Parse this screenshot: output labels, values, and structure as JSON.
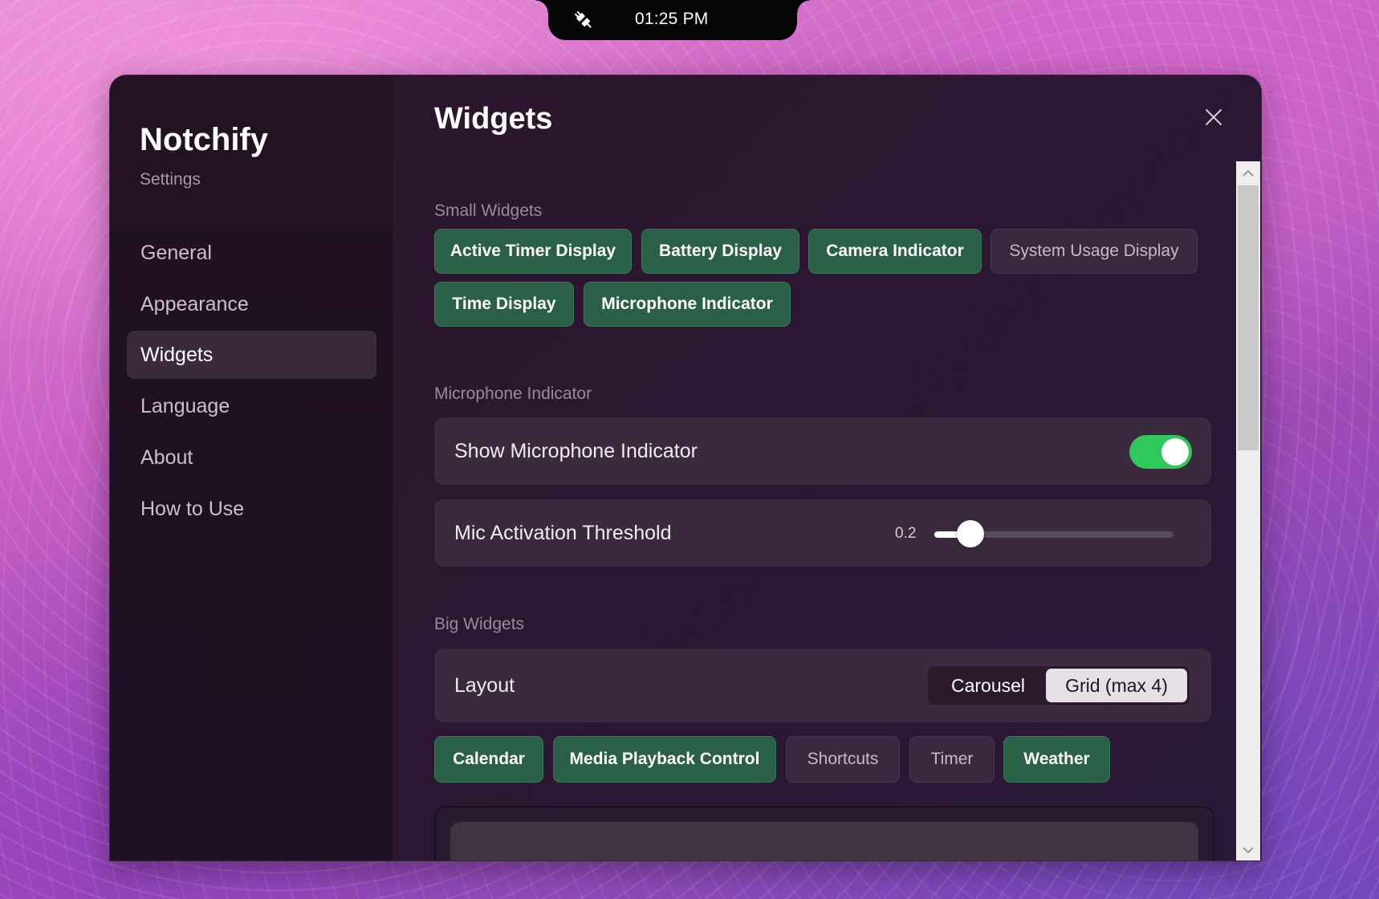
{
  "notch": {
    "time": "01:25 PM",
    "icon": "plug-disconnected-icon"
  },
  "sidebar": {
    "app_name": "Notchify",
    "subtitle": "Settings",
    "items": [
      {
        "label": "General"
      },
      {
        "label": "Appearance"
      },
      {
        "label": "Widgets",
        "active": true
      },
      {
        "label": "Language"
      },
      {
        "label": "About"
      },
      {
        "label": "How to Use"
      }
    ]
  },
  "main": {
    "title": "Widgets",
    "small_widgets": {
      "label": "Small Widgets",
      "chips": [
        {
          "label": "Active Timer Display",
          "enabled": true
        },
        {
          "label": "Battery Display",
          "enabled": true
        },
        {
          "label": "Camera Indicator",
          "enabled": true
        },
        {
          "label": "System Usage Display",
          "enabled": false
        },
        {
          "label": "Time Display",
          "enabled": true
        },
        {
          "label": "Microphone Indicator",
          "enabled": true
        }
      ]
    },
    "microphone": {
      "label": "Microphone Indicator",
      "show_label": "Show Microphone Indicator",
      "show_enabled": true,
      "threshold_label": "Mic Activation Threshold",
      "threshold_value": "0.2",
      "threshold_fraction": 0.15
    },
    "big_widgets": {
      "label": "Big Widgets",
      "layout_label": "Layout",
      "layout_options": [
        "Carousel",
        "Grid (max 4)"
      ],
      "layout_selected": "Grid (max 4)",
      "chips": [
        {
          "label": "Calendar",
          "enabled": true
        },
        {
          "label": "Media Playback Control",
          "enabled": true
        },
        {
          "label": "Shortcuts",
          "enabled": false
        },
        {
          "label": "Timer",
          "enabled": false
        },
        {
          "label": "Weather",
          "enabled": true
        }
      ]
    }
  },
  "colors": {
    "chip_on": "#2a6048",
    "toggle_on": "#2fc85a",
    "window_bg": "#2c1630"
  }
}
